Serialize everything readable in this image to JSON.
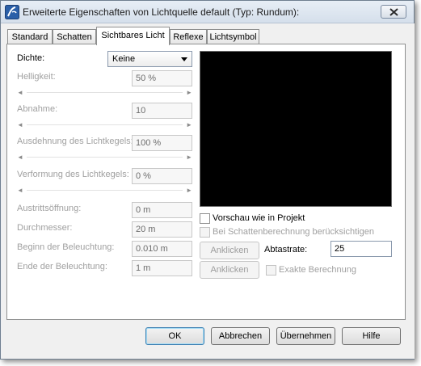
{
  "window": {
    "title": "Erweiterte Eigenschaften von Lichtquelle default (Typ: Rundum):",
    "app_icon": "archicad-icon",
    "close_icon": "close-icon"
  },
  "tabs": [
    {
      "label": "Standard",
      "active": false
    },
    {
      "label": "Schatten",
      "active": false
    },
    {
      "label": "Sichtbares Licht",
      "active": true
    },
    {
      "label": "Reflexe",
      "active": false
    },
    {
      "label": "Lichtsymbol",
      "active": false
    }
  ],
  "settings": {
    "dichte": {
      "label": "Dichte:",
      "value": "Keine"
    },
    "helligkeit": {
      "label": "Helligkeit:",
      "value": "50 %"
    },
    "abnahme": {
      "label": "Abnahme:",
      "value": "10"
    },
    "ausdehnung": {
      "label": "Ausdehnung des Lichtkegels:",
      "value": "100 %"
    },
    "verformung": {
      "label": "Verformung des Lichtkegels:",
      "value": "0 %"
    },
    "austritt": {
      "label": "Austrittsöffnung:",
      "value": "0 m"
    },
    "durchmesser": {
      "label": "Durchmesser:",
      "value": "20 m"
    },
    "beginn": {
      "label": "Beginn der Beleuchtung:",
      "value": "0.010 m"
    },
    "ende": {
      "label": "Ende der Beleuchtung:",
      "value": "1 m"
    }
  },
  "preview": {
    "vorschau_label": "Vorschau wie in Projekt",
    "vorschau_checked": false,
    "schatten_label": "Bei Schattenberechnung berücksichtigen",
    "schatten_checked": false,
    "anklicken_1": "Anklicken",
    "anklicken_2": "Anklicken",
    "abtastrate_label": "Abtastrate:",
    "abtastrate_value": "25",
    "exakt_label": "Exakte Berechnung",
    "exakt_checked": false
  },
  "footer": {
    "ok": "OK",
    "cancel": "Abbrechen",
    "apply": "Übernehmen",
    "help": "Hilfe"
  }
}
